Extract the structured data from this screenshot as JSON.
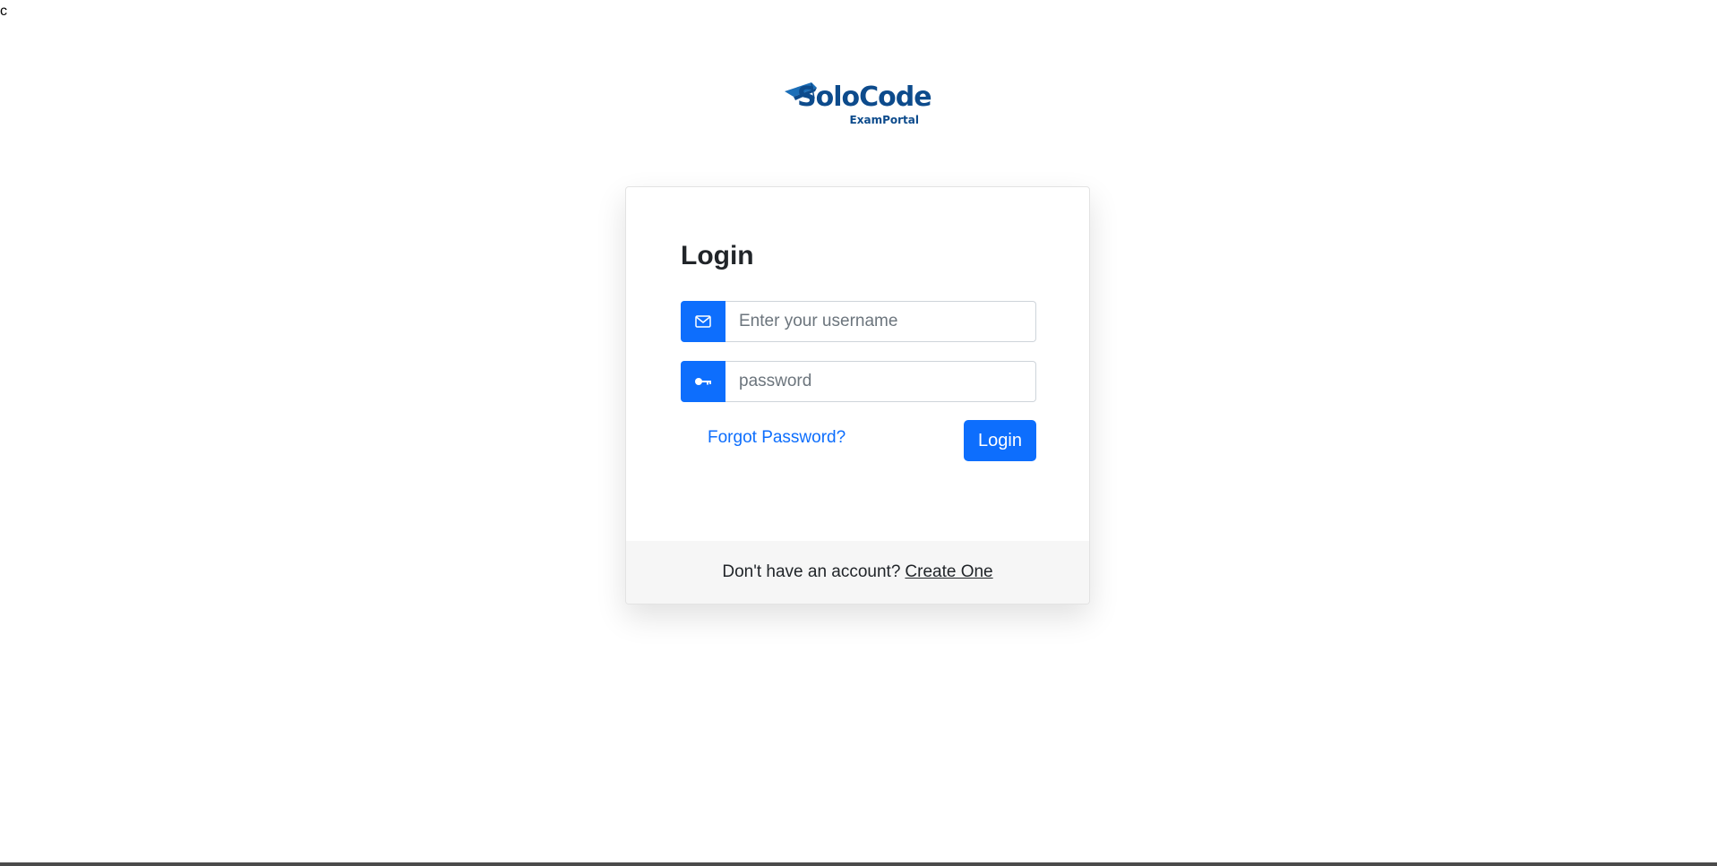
{
  "stray_text": "c",
  "logo": {
    "name": "SoloCode",
    "subtitle": "ExamPortal",
    "color": "#0d4b8c"
  },
  "login": {
    "title": "Login",
    "username": {
      "icon": "envelope-icon",
      "placeholder": "Enter your username",
      "value": ""
    },
    "password": {
      "icon": "key-icon",
      "placeholder": "password",
      "value": ""
    },
    "forgot_label": "Forgot Password?",
    "submit_label": "Login",
    "footer_text": "Don't have an account?",
    "footer_link": "Create One"
  },
  "colors": {
    "primary": "#0d6efd",
    "footer_bg": "#f6f6f6"
  }
}
